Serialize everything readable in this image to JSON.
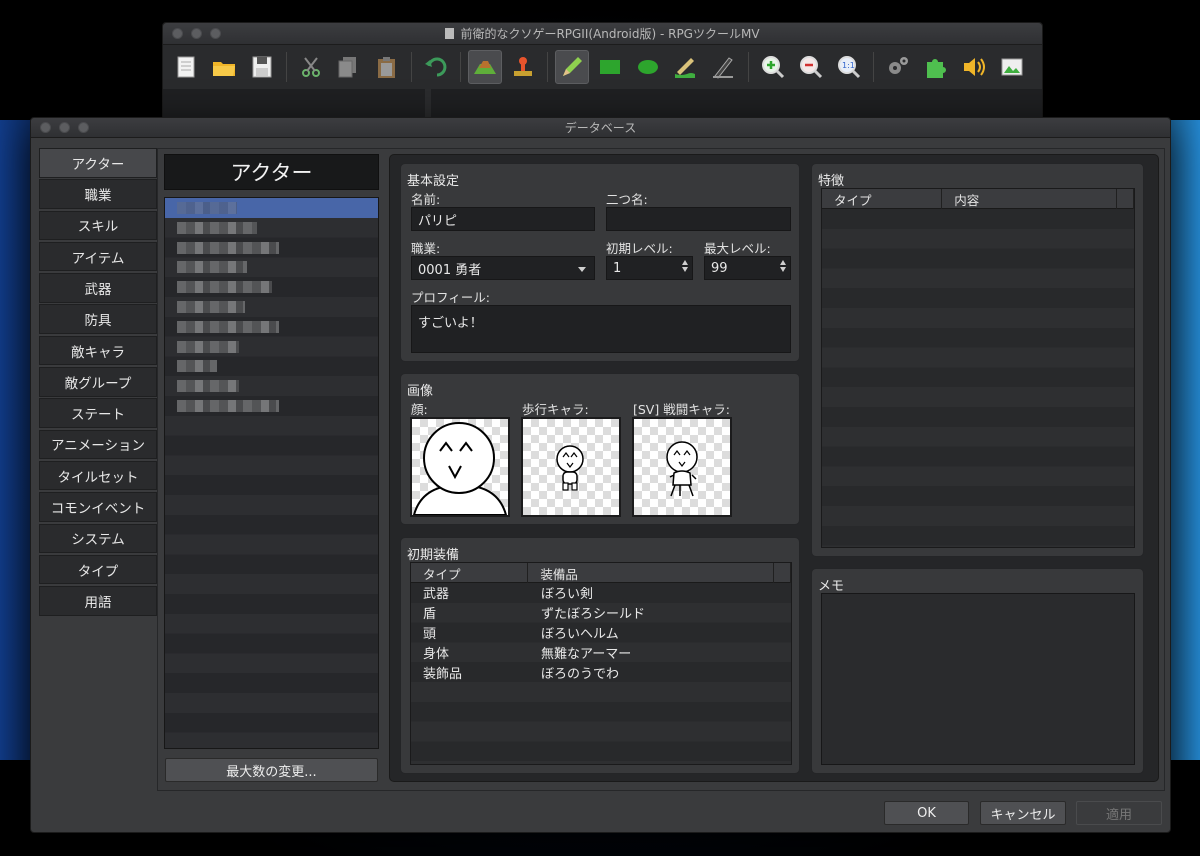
{
  "main_window": {
    "title": "前衛的なクソゲーRPGII(Android版) - RPGツクールMV",
    "toolbar": [
      {
        "name": "new-project-icon",
        "icon": "new-project"
      },
      {
        "name": "open-project-icon",
        "icon": "open-folder"
      },
      {
        "name": "save-project-icon",
        "icon": "save"
      },
      {
        "name": "cut-icon",
        "icon": "scissors"
      },
      {
        "name": "copy-icon",
        "icon": "copy"
      },
      {
        "name": "paste-icon",
        "icon": "clipboard"
      },
      {
        "name": "undo-icon",
        "icon": "undo"
      },
      {
        "name": "map-mode-icon",
        "icon": "map",
        "active": true
      },
      {
        "name": "event-mode-icon",
        "icon": "event-stamp"
      },
      {
        "name": "pencil-icon",
        "icon": "pencil",
        "active": true
      },
      {
        "name": "rectangle-icon",
        "icon": "rectangle"
      },
      {
        "name": "ellipse-icon",
        "icon": "ellipse"
      },
      {
        "name": "flood-fill-icon",
        "icon": "fill"
      },
      {
        "name": "shadow-pen-icon",
        "icon": "shadow-pen"
      },
      {
        "name": "zoom-in-icon",
        "icon": "zoom-in"
      },
      {
        "name": "zoom-out-icon",
        "icon": "zoom-out"
      },
      {
        "name": "zoom-actual-icon",
        "icon": "zoom-1to1"
      },
      {
        "name": "database-gear-icon",
        "icon": "gears"
      },
      {
        "name": "plugin-manager-icon",
        "icon": "puzzle"
      },
      {
        "name": "sound-test-icon",
        "icon": "speaker"
      },
      {
        "name": "event-search-icon",
        "icon": "image"
      }
    ]
  },
  "database": {
    "title": "データベース",
    "categories": [
      {
        "label": "アクター",
        "selected": true
      },
      {
        "label": "職業"
      },
      {
        "label": "スキル"
      },
      {
        "label": "アイテム"
      },
      {
        "label": "武器"
      },
      {
        "label": "防具"
      },
      {
        "label": "敵キャラ"
      },
      {
        "label": "敵グループ"
      },
      {
        "label": "ステート"
      },
      {
        "label": "アニメーション"
      },
      {
        "label": "タイルセット"
      },
      {
        "label": "コモンイベント"
      },
      {
        "label": "システム"
      },
      {
        "label": "タイプ"
      },
      {
        "label": "用語"
      }
    ],
    "actor_header": "アクター",
    "max_button": "最大数の変更...",
    "basic": {
      "title": "基本設定",
      "name_label": "名前:",
      "name_value": "パリピ",
      "nickname_label": "二つ名:",
      "nickname_value": "",
      "class_label": "職業:",
      "class_value": "0001 勇者",
      "init_level_label": "初期レベル:",
      "init_level_value": "1",
      "max_level_label": "最大レベル:",
      "max_level_value": "99",
      "profile_label": "プロフィール:",
      "profile_value": "すごいよ！"
    },
    "images": {
      "title": "画像",
      "face_label": "顔:",
      "walk_label": "歩行キャラ:",
      "battler_label": "[SV] 戦闘キャラ:"
    },
    "equipment": {
      "title": "初期装備",
      "columns": [
        "タイプ",
        "装備品"
      ],
      "rows": [
        [
          "武器",
          "ぼろい剣"
        ],
        [
          "盾",
          "ずたぼろシールド"
        ],
        [
          "頭",
          "ぼろいヘルム"
        ],
        [
          "身体",
          "無難なアーマー"
        ],
        [
          "装飾品",
          "ぼろのうでわ"
        ]
      ]
    },
    "traits": {
      "title": "特徴",
      "columns": [
        "タイプ",
        "内容"
      ]
    },
    "memo": {
      "title": "メモ"
    },
    "buttons": {
      "ok": "OK",
      "cancel": "キャンセル",
      "apply": "適用"
    }
  }
}
